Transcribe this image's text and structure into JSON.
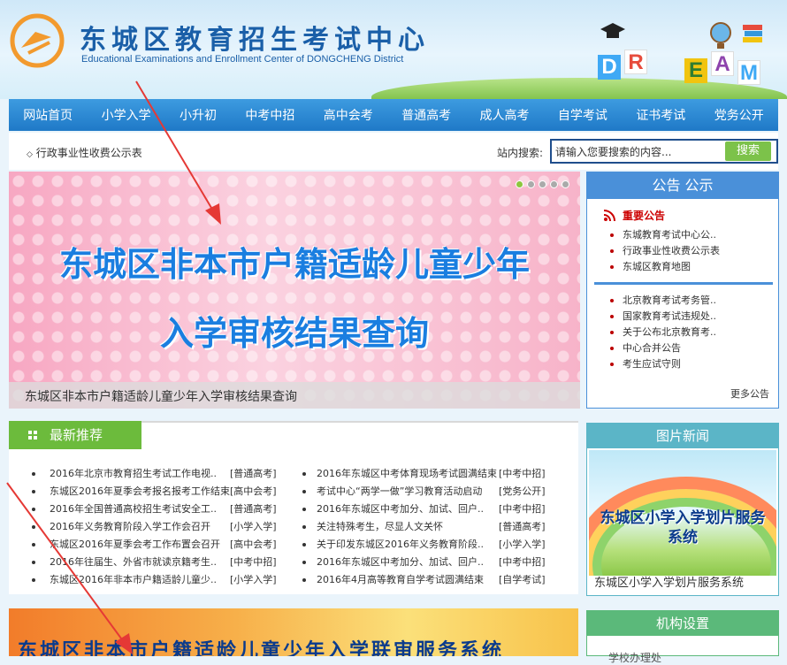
{
  "header": {
    "title": "东城区教育招生考试中心",
    "subtitle": "Educational Examinations and Enrollment Center of DONGCHENG District",
    "dream_letters": [
      "D",
      "R",
      "E",
      "A",
      "M"
    ]
  },
  "nav": [
    "网站首页",
    "小学入学",
    "小升初",
    "中考中招",
    "高中会考",
    "普通高考",
    "成人高考",
    "自学考试",
    "证书考试",
    "党务公开"
  ],
  "subbar": {
    "notice": "行政事业性收费公示表",
    "search_label": "站内搜索:",
    "search_placeholder": "请输入您要搜索的内容...",
    "search_button": "搜索"
  },
  "banner": {
    "line1": "东城区非本市户籍适龄儿童少年",
    "line2": "入学审核结果查询",
    "caption": "东城区非本市户籍适龄儿童少年入学审核结果查询",
    "dots": 5,
    "active_dot": 1
  },
  "notice_panel": {
    "title": "公告 公示",
    "important_title": "重要公告",
    "important_items": [
      "东城教育考试中心公..",
      "行政事业性收费公示表",
      "东城区教育地图"
    ],
    "items": [
      "北京教育考试考务管..",
      "国家教育考试违规处..",
      "关于公布北京教育考..",
      "中心合并公告",
      "考生应试守则"
    ],
    "more": "更多公告"
  },
  "latest": {
    "title": "最新推荐",
    "left": [
      {
        "title": "2016年北京市教育招生考试工作电视..",
        "cat": "[普通高考]"
      },
      {
        "title": "东城区2016年夏季会考报名报考工作结束",
        "cat": "[高中会考]"
      },
      {
        "title": "2016年全国普通高校招生考试安全工..",
        "cat": "[普通高考]"
      },
      {
        "title": "2016年义务教育阶段入学工作会召开",
        "cat": "[小学入学]"
      },
      {
        "title": "东城区2016年夏季会考工作布置会召开",
        "cat": "[高中会考]"
      },
      {
        "title": "2016年往届生、外省市就读京籍考生..",
        "cat": "[中考中招]"
      },
      {
        "title": "东城区2016年非本市户籍适龄儿童少..",
        "cat": "[小学入学]"
      }
    ],
    "right": [
      {
        "title": "2016年东城区中考体育现场考试圆满结束",
        "cat": "[中考中招]"
      },
      {
        "title": "考试中心“两学一做”学习教育活动启动",
        "cat": "[党务公开]"
      },
      {
        "title": "2016年东城区中考加分、加试、回户..",
        "cat": "[中考中招]"
      },
      {
        "title": "关注特殊考生，尽显人文关怀",
        "cat": "[普通高考]"
      },
      {
        "title": "关于印发东城区2016年义务教育阶段..",
        "cat": "[小学入学]"
      },
      {
        "title": "2016年东城区中考加分、加试、回户..",
        "cat": "[中考中招]"
      },
      {
        "title": "2016年4月高等教育自学考试圆满结束",
        "cat": "[自学考试]"
      }
    ]
  },
  "photo_news": {
    "title": "图片新闻",
    "image_text": "东城区小学入学划片服务系统",
    "caption": "东城区小学入学划片服务系统"
  },
  "bottom_banner": "东城区非本市户籍适龄儿童少年入学联审服务系统",
  "org": {
    "title": "机构设置",
    "peek": "学校办理处"
  },
  "colors": {
    "nav_blue": "#2b86d4",
    "accent_green": "#6cbb3c",
    "banner_text": "#1a7ee0",
    "arrow_red": "#e53935"
  }
}
